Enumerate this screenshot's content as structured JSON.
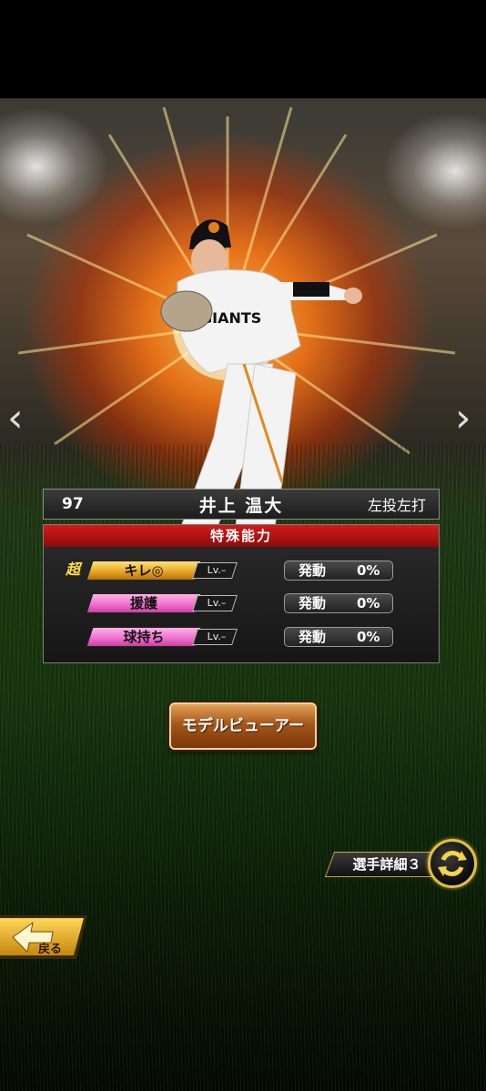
{
  "player": {
    "number": "97",
    "name": "井上 温大",
    "type": "左投左打",
    "cap_logo": "YG",
    "jersey_text": "GIANTS"
  },
  "abilities": {
    "header": "特殊能力",
    "items": [
      {
        "prefix": "超",
        "name": "キレ◎",
        "level": "Lv.–",
        "activate_label": "発動",
        "activate_value": "0%",
        "color": "#e5a11c"
      },
      {
        "prefix": "",
        "name": "援護",
        "level": "Lv.–",
        "activate_label": "発動",
        "activate_value": "0%",
        "color": "#f06ccd"
      },
      {
        "prefix": "",
        "name": "球持ち",
        "level": "Lv.–",
        "activate_label": "発動",
        "activate_value": "0%",
        "color": "#f06ccd"
      }
    ]
  },
  "buttons": {
    "model_viewer": "モデルビューアー",
    "player_detail": "選手詳細３",
    "back": "戻る"
  },
  "nav": {
    "prev_icon": "chevron-left-icon",
    "next_icon": "chevron-right-icon"
  },
  "colors": {
    "accent_red": "#c81414",
    "gold": "#e1c043"
  }
}
